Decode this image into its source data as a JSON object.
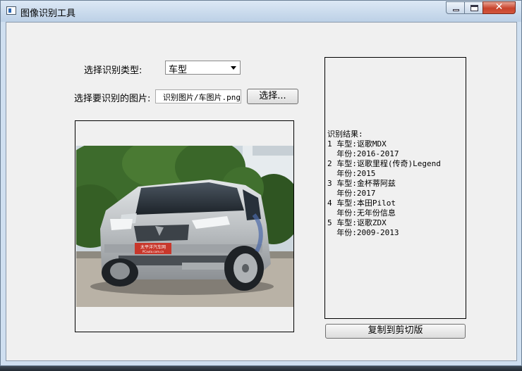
{
  "window": {
    "title": "图像识别工具",
    "controls": {
      "minimize": "minimize-icon",
      "maximize": "maximize-icon",
      "close": "✕"
    }
  },
  "form": {
    "type_label": "选择识别类型:",
    "type_selected": "车型",
    "image_label": "选择要识别的图片:",
    "image_path": "识别图片/车图片.png",
    "choose_button": "选择..."
  },
  "photo": {
    "plate_line1": "太平洋汽车网",
    "plate_line2": "PCauto.com.cn"
  },
  "result": {
    "text": "识别结果:\n1 车型:讴歌MDX\n  年份:2016-2017\n2 车型:讴歌里程(传奇)Legend\n  年份:2015\n3 车型:金杯蒂阿兹\n  年份:2017\n4 车型:本田Pilot\n  年份:无年份信息\n5 车型:讴歌ZDX\n  年份:2009-2013"
  },
  "actions": {
    "copy_button": "复制到剪切版"
  }
}
